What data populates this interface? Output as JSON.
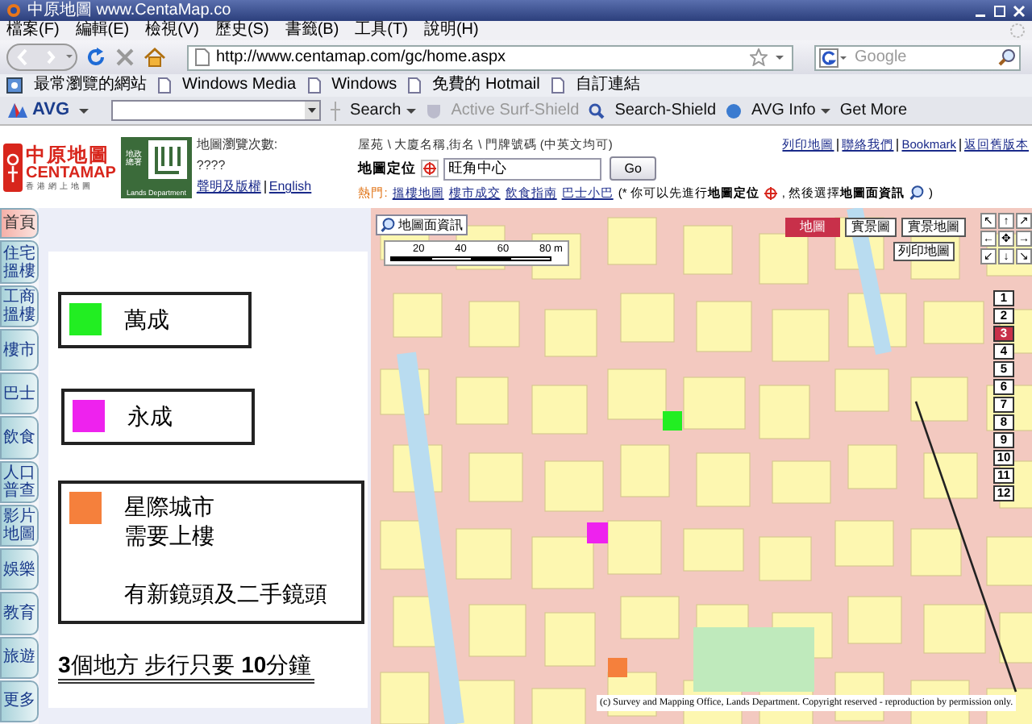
{
  "window": {
    "title": "中原地圖 www.CentaMap.co"
  },
  "menu": [
    "檔案(F)",
    "編輯(E)",
    "檢視(V)",
    "歷史(S)",
    "書籤(B)",
    "工具(T)",
    "說明(H)"
  ],
  "nav": {
    "url": "http://www.centamap.com/gc/home.aspx",
    "search_placeholder": "Google"
  },
  "bookmarks": [
    "最常瀏覽的網站",
    "Windows Media",
    "Windows",
    "免費的 Hotmail",
    "自訂連結"
  ],
  "avg_toolbar": {
    "logo": "AVG",
    "items": [
      {
        "label": "Search",
        "has_menu": true,
        "disabled": false
      },
      {
        "label": "Active Surf-Shield",
        "has_menu": false,
        "disabled": true
      },
      {
        "label": "Search-Shield",
        "has_menu": false,
        "disabled": false
      },
      {
        "label": "AVG Info",
        "has_menu": true,
        "disabled": false
      },
      {
        "label": "Get More",
        "has_menu": false,
        "disabled": false
      }
    ]
  },
  "header": {
    "logo_title": "中原地圖",
    "logo_brand": "CENTAMAP",
    "logo_sub": "香港網上地圖",
    "lands_logo": "地政總署",
    "lands_label": "Lands Department",
    "visits_label": "地圖瀏覽次數:",
    "visits": "????",
    "links": [
      "聲明及版權",
      "English"
    ]
  },
  "search": {
    "hint": "屋苑 \\ 大廈名稱,街名 \\ 門牌號碼 (中英文均可)",
    "label": "地圖定位",
    "value": "旺角中心",
    "button": "Go"
  },
  "hot": {
    "label": "熱門:",
    "links": [
      "搵樓地圖",
      "樓市成交",
      "飲食指南",
      "巴士小巴"
    ],
    "note_parts": [
      "(* 你可以先進行**地圖定位**",
      ", 然後選擇**地圖面資訊**",
      ")"
    ]
  },
  "top_links": [
    "列印地圖",
    "聯絡我們",
    "Bookmark",
    "返回舊版本"
  ],
  "side_tabs": [
    {
      "label": "首頁",
      "selected": true
    },
    {
      "label": "住宅搵樓",
      "selected": false
    },
    {
      "label": "工商搵樓",
      "selected": false
    },
    {
      "label": "樓市",
      "selected": false
    },
    {
      "label": "巴士",
      "selected": false
    },
    {
      "label": "飲食",
      "selected": false
    },
    {
      "label": "人口普查",
      "selected": false
    },
    {
      "label": "影片地圖",
      "selected": false
    },
    {
      "label": "娛樂",
      "selected": false
    },
    {
      "label": "教育",
      "selected": false
    },
    {
      "label": "旅遊",
      "selected": false
    },
    {
      "label": "更多",
      "selected": false
    }
  ],
  "callouts": [
    {
      "color": "#22ee22",
      "lines": [
        "萬成"
      ]
    },
    {
      "color": "#ee22ee",
      "lines": [
        "永成"
      ]
    },
    {
      "color": "#f5803c",
      "lines": [
        "星際城市",
        "需要上樓"
      ],
      "detail": "有新鏡頭及二手鏡頭"
    }
  ],
  "caption": "**3**個地方 步行只要 **10**分鐘",
  "map": {
    "info_button": "地圖面資訊",
    "tabs": [
      {
        "label": "地圖",
        "selected": true
      },
      {
        "label": "實景圖",
        "selected": false
      },
      {
        "label": "實景地圖",
        "selected": false
      }
    ],
    "print_button": "列印地圖",
    "scale_labels": [
      "20",
      "40",
      "60",
      "80 m"
    ],
    "pan_arrows": [
      "↖",
      "↑",
      "↗",
      "←",
      "✥",
      "→",
      "↙",
      "↓",
      "↘"
    ],
    "zoom_levels": [
      {
        "label": "1",
        "selected": false
      },
      {
        "label": "2",
        "selected": false
      },
      {
        "label": "3",
        "selected": true
      },
      {
        "label": "4",
        "selected": false
      },
      {
        "label": "5",
        "selected": false
      },
      {
        "label": "6",
        "selected": false
      },
      {
        "label": "7",
        "selected": false
      },
      {
        "label": "8",
        "selected": false
      },
      {
        "label": "9",
        "selected": false
      },
      {
        "label": "10",
        "selected": false
      },
      {
        "label": "11",
        "selected": false
      },
      {
        "label": "12",
        "selected": false
      }
    ],
    "copyright": "(c) Survey and Mapping Office, Lands Department. Copyright reserved - reproduction by permission only."
  }
}
